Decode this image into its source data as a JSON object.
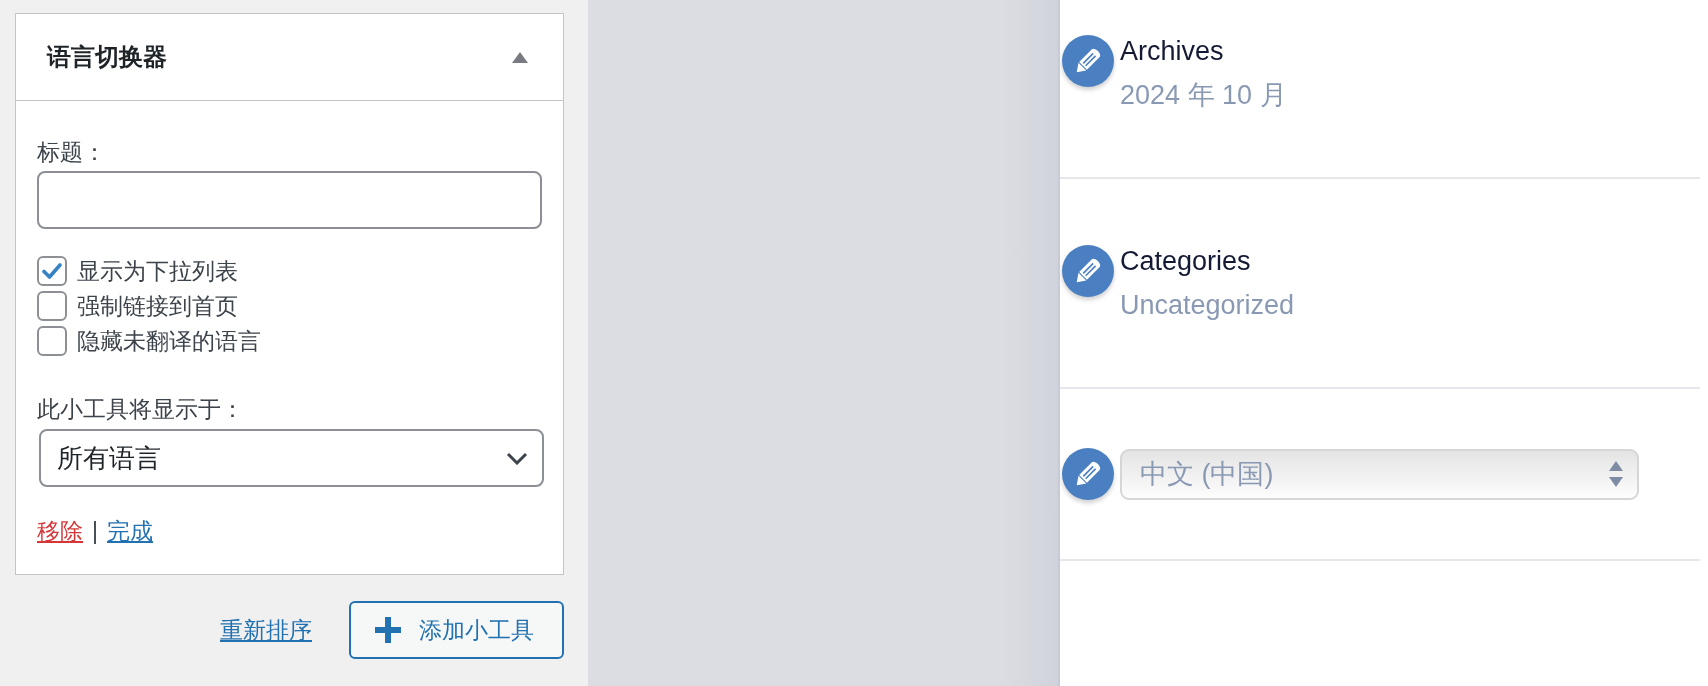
{
  "widget": {
    "title": "语言切换器",
    "expanded": true,
    "title_field": {
      "label": "标题："
    },
    "options": [
      {
        "label": "显示为下拉列表",
        "checked": true
      },
      {
        "label": "强制链接到首页",
        "checked": false
      },
      {
        "label": "隐藏未翻译的语言",
        "checked": false
      }
    ],
    "display_for": {
      "label": "此小工具将显示于：",
      "value": "所有语言"
    },
    "actions": [
      {
        "label": "移除",
        "kind": "danger"
      },
      {
        "label": "完成",
        "kind": "primary"
      }
    ],
    "action_separator": "|"
  },
  "footer": {
    "reorder_link": "重新排序",
    "add_button": "添加小工具"
  },
  "preview": {
    "widgets": [
      {
        "kind": "text",
        "title": "Archives",
        "value": "2024 年 10 月"
      },
      {
        "kind": "text",
        "title": "Categories",
        "value": "Uncategorized"
      },
      {
        "kind": "select",
        "value": "中文 (中国)"
      }
    ]
  }
}
